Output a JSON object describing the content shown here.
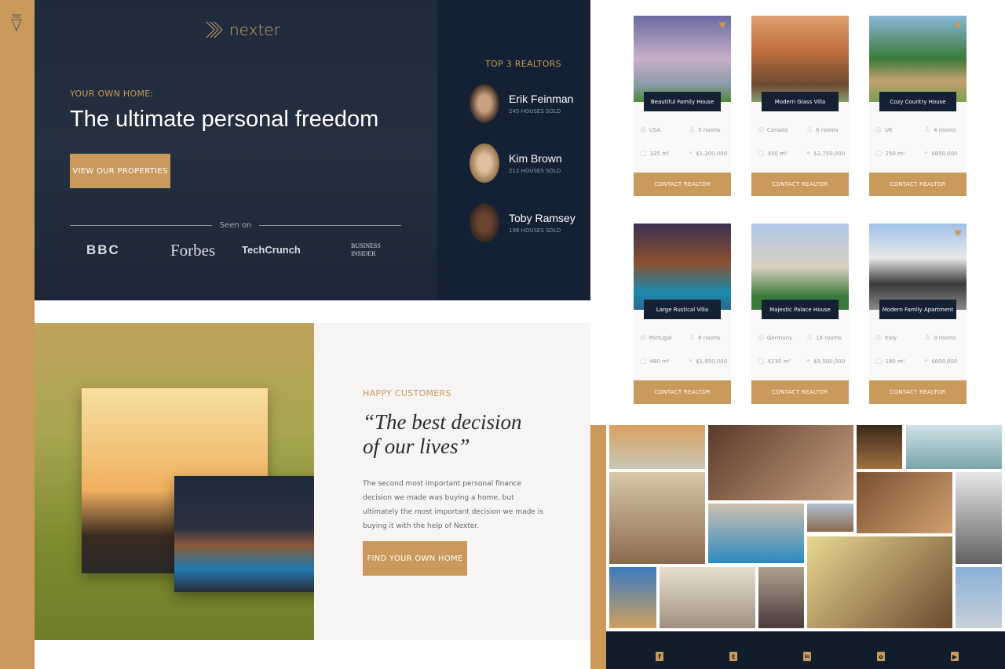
{
  "brand": {
    "name": "nexter",
    "accent": "#c99a5b",
    "dark": "#142033"
  },
  "hero": {
    "kicker": "YOUR OWN HOME:",
    "title": "The ultimate personal freedom",
    "cta": "VIEW OUR PROPERTIES",
    "seen_on": "Seen on",
    "press": [
      "BBC",
      "Forbes",
      "TechCrunch",
      "BUSINESS INSIDER"
    ]
  },
  "realtors": {
    "title": "TOP 3 REALTORS",
    "items": [
      {
        "name": "Erik Feinman",
        "sold": "245 HOUSES SOLD"
      },
      {
        "name": "Kim Brown",
        "sold": "212 HOUSES SOLD"
      },
      {
        "name": "Toby Ramsey",
        "sold": "198 HOUSES SOLD"
      }
    ]
  },
  "testimonial": {
    "kicker": "HAPPY CUSTOMERS",
    "quote": "“The best decision of our lives”",
    "text": "The second most important personal finance decision we made was buying a home, but ultimately the most important decision we made is buying it with the help of Nexter.",
    "cta": "FIND YOUR OWN HOME"
  },
  "homes": [
    {
      "title": "Beautiful Family House",
      "country": "USA",
      "rooms": "5 rooms",
      "area": "325 m²",
      "price": "$1,200,000",
      "button": "CONTACT REALTOR",
      "favorite": true
    },
    {
      "title": "Modern Glass Villa",
      "country": "Canada",
      "rooms": "6 rooms",
      "area": "450 m²",
      "price": "$2,750,000",
      "button": "CONTACT REALTOR",
      "favorite": true
    },
    {
      "title": "Cozy Country House",
      "country": "UK",
      "rooms": "4 rooms",
      "area": "250 m²",
      "price": "$850,000",
      "button": "CONTACT REALTOR",
      "favorite": true
    },
    {
      "title": "Large Rustical Villa",
      "country": "Portugal",
      "rooms": "6 rooms",
      "area": "480 m²",
      "price": "$1,950,000",
      "button": "CONTACT REALTOR",
      "favorite": false
    },
    {
      "title": "Majestic Palace House",
      "country": "Germany",
      "rooms": "18 rooms",
      "area": "4230 m²",
      "price": "$9,500,000",
      "button": "CONTACT REALTOR",
      "favorite": false
    },
    {
      "title": "Modern Family Apartment",
      "country": "Italy",
      "rooms": "3 rooms",
      "area": "180 m²",
      "price": "$600,000",
      "button": "CONTACT REALTOR",
      "favorite": true
    }
  ],
  "footer": {
    "social": [
      "facebook-icon",
      "twitter-icon",
      "linkedin-icon",
      "instagram-icon",
      "youtube-icon"
    ]
  }
}
